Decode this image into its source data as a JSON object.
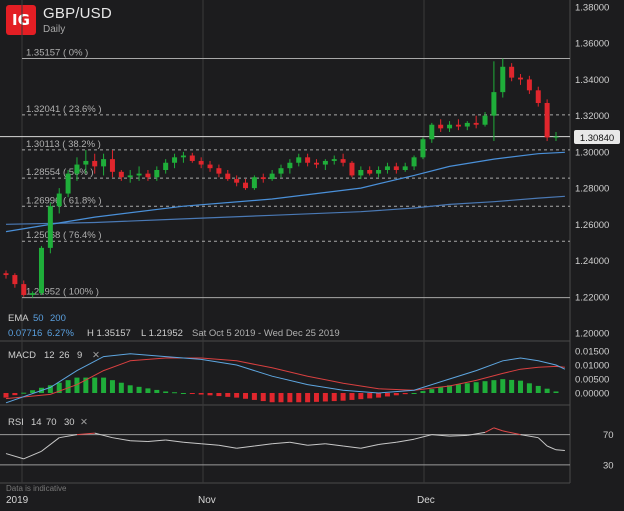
{
  "header": {
    "logo": "IG",
    "pair": "GBP/USD",
    "timeframe": "Daily"
  },
  "colors": {
    "bg": "#1c1c1e",
    "up": "#1fae3a",
    "down": "#e0262d",
    "ema50": "#4a90d9",
    "ema200": "#4a79b5",
    "macd": "#5ea6e0",
    "signal": "#d94040",
    "rsi": "#c8c8c8",
    "grid": "#7a7a7a"
  },
  "price_axis": [
    "1.38000",
    "1.36000",
    "1.34000",
    "1.32000",
    "1.30000",
    "1.28000",
    "1.26000",
    "1.24000",
    "1.22000",
    "1.20000"
  ],
  "current_price": "1.30840",
  "fib_levels": [
    {
      "label": "1.35157 ( 0% )",
      "price": 1.35157
    },
    {
      "label": "1.32041 ( 23.6% )",
      "price": 1.32041
    },
    {
      "label": "1.30113 ( 38.2% )",
      "price": 1.30113
    },
    {
      "label": "1.28554 ( 50% )",
      "price": 1.28554
    },
    {
      "label": "1.26996 ( 61.8% )",
      "price": 1.26996
    },
    {
      "label": "1.25068 ( 76.4% )",
      "price": 1.25068
    },
    {
      "label": "1.21952 ( 100% )",
      "price": 1.21952
    }
  ],
  "ema": {
    "label": "EMA",
    "period_50": "50",
    "period_200": "200",
    "change": "0.07716",
    "change_pct": "6.27%",
    "high": "H 1.35157",
    "low": "L 1.21952",
    "range": "Sat Oct 5 2019 - Wed Dec 25 2019"
  },
  "macd": {
    "label": "MACD",
    "fast": "12",
    "slow": "26",
    "signal": "9",
    "close": "✕",
    "axis": [
      "0.01500",
      "0.01000",
      "0.00500",
      "0.00000"
    ]
  },
  "rsi": {
    "label": "RSI",
    "period": "14",
    "upper": "70",
    "lower": "30",
    "close": "✕",
    "axis": [
      "70",
      "30"
    ]
  },
  "watermark": "Data is indicative",
  "x_axis": [
    "2019",
    "Nov",
    "Dec"
  ],
  "chart_data": {
    "type": "candlestick",
    "x_range": [
      "2019-10-05",
      "2019-12-25"
    ],
    "ylim": [
      1.2,
      1.38
    ],
    "candles": [
      [
        1.233,
        1.2345,
        1.23,
        1.232
      ],
      [
        1.232,
        1.233,
        1.225,
        1.227
      ],
      [
        1.227,
        1.229,
        1.22,
        1.221
      ],
      [
        1.221,
        1.223,
        1.2195,
        1.222
      ],
      [
        1.222,
        1.248,
        1.221,
        1.247
      ],
      [
        1.247,
        1.272,
        1.244,
        1.27
      ],
      [
        1.27,
        1.28,
        1.266,
        1.277
      ],
      [
        1.277,
        1.29,
        1.275,
        1.288
      ],
      [
        1.288,
        1.297,
        1.284,
        1.293
      ],
      [
        1.293,
        1.301,
        1.288,
        1.295
      ],
      [
        1.295,
        1.299,
        1.288,
        1.292
      ],
      [
        1.292,
        1.299,
        1.287,
        1.296
      ],
      [
        1.296,
        1.301,
        1.286,
        1.289
      ],
      [
        1.289,
        1.29,
        1.284,
        1.286
      ],
      [
        1.286,
        1.29,
        1.283,
        1.287
      ],
      [
        1.287,
        1.292,
        1.284,
        1.288
      ],
      [
        1.288,
        1.29,
        1.284,
        1.286
      ],
      [
        1.286,
        1.292,
        1.284,
        1.29
      ],
      [
        1.29,
        1.296,
        1.288,
        1.294
      ],
      [
        1.294,
        1.299,
        1.291,
        1.297
      ],
      [
        1.297,
        1.3,
        1.294,
        1.298
      ],
      [
        1.298,
        1.2995,
        1.294,
        1.295
      ],
      [
        1.295,
        1.297,
        1.291,
        1.293
      ],
      [
        1.293,
        1.295,
        1.289,
        1.291
      ],
      [
        1.291,
        1.293,
        1.286,
        1.288
      ],
      [
        1.288,
        1.29,
        1.284,
        1.285
      ],
      [
        1.285,
        1.287,
        1.281,
        1.283
      ],
      [
        1.283,
        1.285,
        1.279,
        1.28
      ],
      [
        1.28,
        1.287,
        1.279,
        1.286
      ],
      [
        1.286,
        1.288,
        1.283,
        1.285
      ],
      [
        1.285,
        1.29,
        1.284,
        1.288
      ],
      [
        1.288,
        1.293,
        1.286,
        1.291
      ],
      [
        1.291,
        1.296,
        1.288,
        1.294
      ],
      [
        1.294,
        1.299,
        1.292,
        1.297
      ],
      [
        1.297,
        1.299,
        1.292,
        1.294
      ],
      [
        1.294,
        1.296,
        1.291,
        1.293
      ],
      [
        1.293,
        1.296,
        1.29,
        1.295
      ],
      [
        1.295,
        1.298,
        1.293,
        1.296
      ],
      [
        1.296,
        1.299,
        1.292,
        1.294
      ],
      [
        1.294,
        1.295,
        1.286,
        1.287
      ],
      [
        1.287,
        1.292,
        1.285,
        1.29
      ],
      [
        1.29,
        1.292,
        1.287,
        1.288
      ],
      [
        1.288,
        1.292,
        1.286,
        1.29
      ],
      [
        1.29,
        1.294,
        1.288,
        1.292
      ],
      [
        1.292,
        1.294,
        1.288,
        1.29
      ],
      [
        1.29,
        1.294,
        1.289,
        1.292
      ],
      [
        1.292,
        1.298,
        1.29,
        1.297
      ],
      [
        1.297,
        1.308,
        1.296,
        1.307
      ],
      [
        1.307,
        1.316,
        1.305,
        1.315
      ],
      [
        1.315,
        1.318,
        1.311,
        1.313
      ],
      [
        1.313,
        1.317,
        1.311,
        1.315
      ],
      [
        1.315,
        1.318,
        1.312,
        1.314
      ],
      [
        1.314,
        1.317,
        1.312,
        1.316
      ],
      [
        1.316,
        1.32,
        1.313,
        1.315
      ],
      [
        1.315,
        1.322,
        1.314,
        1.32
      ],
      [
        1.32,
        1.35,
        1.306,
        1.333
      ],
      [
        1.333,
        1.3515,
        1.33,
        1.347
      ],
      [
        1.347,
        1.349,
        1.339,
        1.341
      ],
      [
        1.341,
        1.343,
        1.337,
        1.34
      ],
      [
        1.34,
        1.342,
        1.332,
        1.334
      ],
      [
        1.334,
        1.336,
        1.325,
        1.327
      ],
      [
        1.327,
        1.329,
        1.306,
        1.308
      ],
      [
        1.308,
        1.311,
        1.306,
        1.3084
      ]
    ],
    "ema50": [
      [
        0,
        1.256
      ],
      [
        10,
        1.264
      ],
      [
        20,
        1.27
      ],
      [
        30,
        1.274
      ],
      [
        40,
        1.28
      ],
      [
        46,
        1.287
      ],
      [
        50,
        1.292
      ],
      [
        55,
        1.296
      ],
      [
        60,
        1.299
      ],
      [
        63,
        1.2998
      ]
    ],
    "ema200": [
      [
        0,
        1.26
      ],
      [
        10,
        1.261
      ],
      [
        20,
        1.263
      ],
      [
        30,
        1.265
      ],
      [
        40,
        1.267
      ],
      [
        46,
        1.269
      ],
      [
        50,
        1.271
      ],
      [
        55,
        1.2725
      ],
      [
        60,
        1.2745
      ],
      [
        63,
        1.2755
      ]
    ],
    "macd_line": [
      [
        0,
        -0.0035
      ],
      [
        5,
        0.002
      ],
      [
        8,
        0.008
      ],
      [
        11,
        0.013
      ],
      [
        14,
        0.014
      ],
      [
        18,
        0.013
      ],
      [
        22,
        0.012
      ],
      [
        26,
        0.01
      ],
      [
        30,
        0.006
      ],
      [
        34,
        0.003
      ],
      [
        38,
        0.001
      ],
      [
        42,
        0.0
      ],
      [
        46,
        0.001
      ],
      [
        50,
        0.005
      ],
      [
        53,
        0.008
      ],
      [
        56,
        0.0115
      ],
      [
        58,
        0.0125
      ],
      [
        60,
        0.0115
      ],
      [
        62,
        0.01
      ],
      [
        63,
        0.0085
      ]
    ],
    "signal_line": [
      [
        0,
        -0.002
      ],
      [
        5,
        -0.0005
      ],
      [
        8,
        0.003
      ],
      [
        11,
        0.008
      ],
      [
        14,
        0.0115
      ],
      [
        18,
        0.0125
      ],
      [
        22,
        0.0125
      ],
      [
        26,
        0.0115
      ],
      [
        30,
        0.009
      ],
      [
        34,
        0.006
      ],
      [
        38,
        0.0035
      ],
      [
        42,
        0.0015
      ],
      [
        46,
        0.001
      ],
      [
        50,
        0.0025
      ],
      [
        53,
        0.0045
      ],
      [
        56,
        0.007
      ],
      [
        58,
        0.0085
      ],
      [
        60,
        0.0092
      ],
      [
        62,
        0.0095
      ],
      [
        63,
        0.0092
      ]
    ],
    "rsi": [
      [
        0,
        45
      ],
      [
        2,
        38
      ],
      [
        4,
        48
      ],
      [
        6,
        66
      ],
      [
        8,
        70
      ],
      [
        10,
        72
      ],
      [
        12,
        66
      ],
      [
        14,
        62
      ],
      [
        16,
        61
      ],
      [
        18,
        63
      ],
      [
        20,
        60
      ],
      [
        22,
        58
      ],
      [
        24,
        56
      ],
      [
        26,
        52
      ],
      [
        28,
        55
      ],
      [
        30,
        58
      ],
      [
        32,
        60
      ],
      [
        34,
        56
      ],
      [
        36,
        58
      ],
      [
        38,
        55
      ],
      [
        40,
        52
      ],
      [
        42,
        57
      ],
      [
        44,
        60
      ],
      [
        46,
        64
      ],
      [
        48,
        70
      ],
      [
        50,
        68
      ],
      [
        52,
        69
      ],
      [
        54,
        73
      ],
      [
        55,
        79
      ],
      [
        56,
        75
      ],
      [
        58,
        70
      ],
      [
        60,
        66
      ],
      [
        61,
        55
      ],
      [
        62,
        50
      ],
      [
        63,
        49
      ]
    ]
  }
}
